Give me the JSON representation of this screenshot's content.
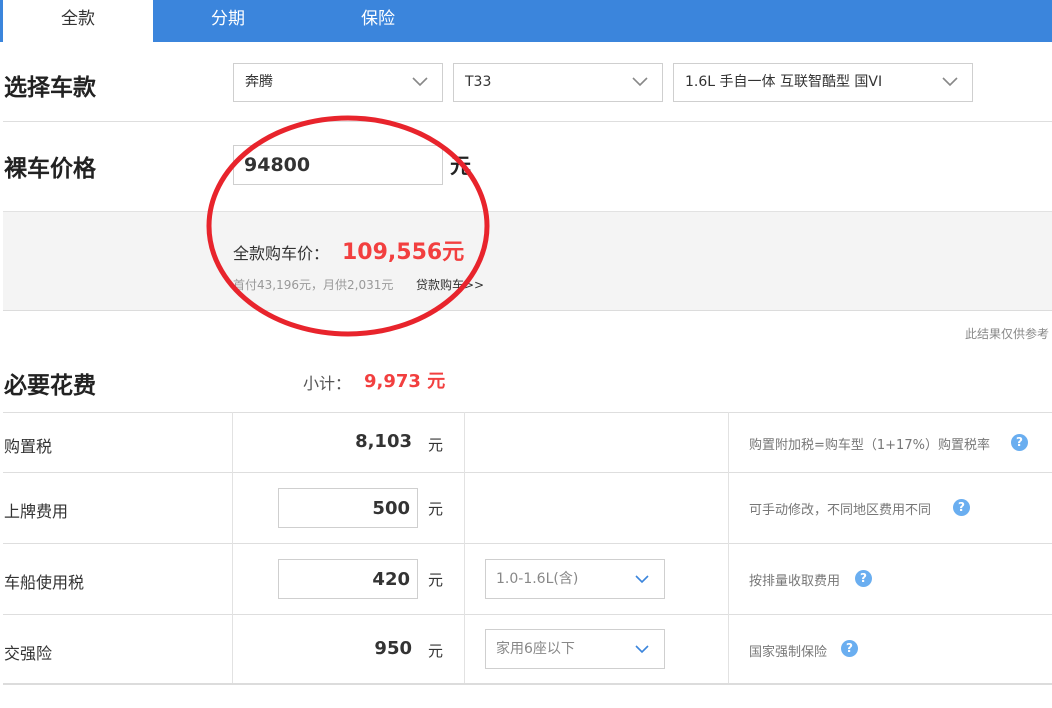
{
  "tabs": [
    {
      "label": "全款"
    },
    {
      "label": "分期"
    },
    {
      "label": "保险"
    }
  ],
  "select_car": {
    "title": "选择车款",
    "brand": "奔腾",
    "model": "T33",
    "version": "1.6L 手自一体 互联智酷型 国VI"
  },
  "bare_price": {
    "title": "裸车价格",
    "value": "94800",
    "unit": "元"
  },
  "summary": {
    "total_label": "全款购车价：",
    "total_value": "109,556元",
    "sub_text": "首付43,196元，月供2,031元",
    "loan_link": "贷款购车>>"
  },
  "note": "此结果仅供参考",
  "required_costs": {
    "title": "必要花费",
    "subtotal_label": "小计：",
    "subtotal_value": "9,973 元",
    "rows": [
      {
        "label": "购置税",
        "value": "8,103",
        "unit": "元",
        "hint": "购置附加税=购车型（1+17%）购置税率"
      },
      {
        "label": "上牌费用",
        "value": "500",
        "unit": "元",
        "hint": "可手动修改，不同地区费用不同"
      },
      {
        "label": "车船使用税",
        "value": "420",
        "unit": "元",
        "option": "1.0-1.6L(含)",
        "hint": "按排量收取费用"
      },
      {
        "label": "交强险",
        "value": "950",
        "unit": "元",
        "option": "家用6座以下",
        "hint": "国家强制保险"
      }
    ]
  },
  "icons": {
    "help": "?",
    "chevron": "chevron-down-icon"
  },
  "colors": {
    "tab_bar": "#3b85dc",
    "highlight": "#f23f3f",
    "help_icon": "#6aaef0",
    "annotation_circle": "#e8242c"
  }
}
